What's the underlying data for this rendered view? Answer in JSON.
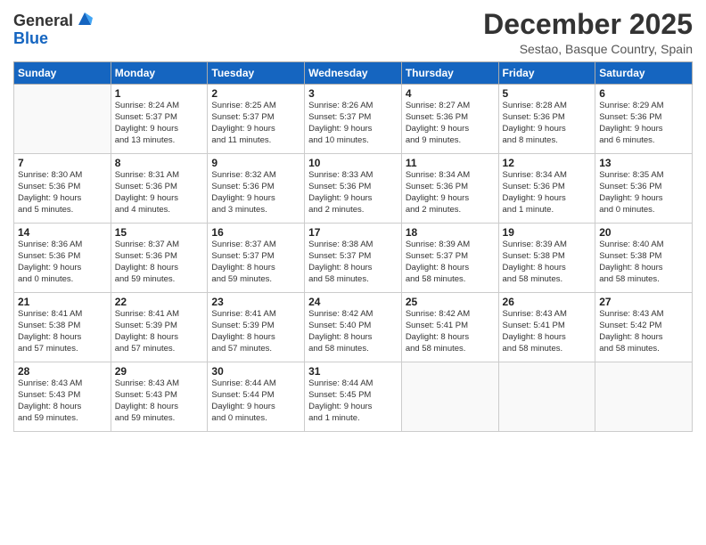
{
  "header": {
    "logo_general": "General",
    "logo_blue": "Blue",
    "month_title": "December 2025",
    "location": "Sestao, Basque Country, Spain"
  },
  "days_of_week": [
    "Sunday",
    "Monday",
    "Tuesday",
    "Wednesday",
    "Thursday",
    "Friday",
    "Saturday"
  ],
  "weeks": [
    [
      {
        "day": "",
        "info": ""
      },
      {
        "day": "1",
        "info": "Sunrise: 8:24 AM\nSunset: 5:37 PM\nDaylight: 9 hours\nand 13 minutes."
      },
      {
        "day": "2",
        "info": "Sunrise: 8:25 AM\nSunset: 5:37 PM\nDaylight: 9 hours\nand 11 minutes."
      },
      {
        "day": "3",
        "info": "Sunrise: 8:26 AM\nSunset: 5:37 PM\nDaylight: 9 hours\nand 10 minutes."
      },
      {
        "day": "4",
        "info": "Sunrise: 8:27 AM\nSunset: 5:36 PM\nDaylight: 9 hours\nand 9 minutes."
      },
      {
        "day": "5",
        "info": "Sunrise: 8:28 AM\nSunset: 5:36 PM\nDaylight: 9 hours\nand 8 minutes."
      },
      {
        "day": "6",
        "info": "Sunrise: 8:29 AM\nSunset: 5:36 PM\nDaylight: 9 hours\nand 6 minutes."
      }
    ],
    [
      {
        "day": "7",
        "info": "Sunrise: 8:30 AM\nSunset: 5:36 PM\nDaylight: 9 hours\nand 5 minutes."
      },
      {
        "day": "8",
        "info": "Sunrise: 8:31 AM\nSunset: 5:36 PM\nDaylight: 9 hours\nand 4 minutes."
      },
      {
        "day": "9",
        "info": "Sunrise: 8:32 AM\nSunset: 5:36 PM\nDaylight: 9 hours\nand 3 minutes."
      },
      {
        "day": "10",
        "info": "Sunrise: 8:33 AM\nSunset: 5:36 PM\nDaylight: 9 hours\nand 2 minutes."
      },
      {
        "day": "11",
        "info": "Sunrise: 8:34 AM\nSunset: 5:36 PM\nDaylight: 9 hours\nand 2 minutes."
      },
      {
        "day": "12",
        "info": "Sunrise: 8:34 AM\nSunset: 5:36 PM\nDaylight: 9 hours\nand 1 minute."
      },
      {
        "day": "13",
        "info": "Sunrise: 8:35 AM\nSunset: 5:36 PM\nDaylight: 9 hours\nand 0 minutes."
      }
    ],
    [
      {
        "day": "14",
        "info": "Sunrise: 8:36 AM\nSunset: 5:36 PM\nDaylight: 9 hours\nand 0 minutes."
      },
      {
        "day": "15",
        "info": "Sunrise: 8:37 AM\nSunset: 5:36 PM\nDaylight: 8 hours\nand 59 minutes."
      },
      {
        "day": "16",
        "info": "Sunrise: 8:37 AM\nSunset: 5:37 PM\nDaylight: 8 hours\nand 59 minutes."
      },
      {
        "day": "17",
        "info": "Sunrise: 8:38 AM\nSunset: 5:37 PM\nDaylight: 8 hours\nand 58 minutes."
      },
      {
        "day": "18",
        "info": "Sunrise: 8:39 AM\nSunset: 5:37 PM\nDaylight: 8 hours\nand 58 minutes."
      },
      {
        "day": "19",
        "info": "Sunrise: 8:39 AM\nSunset: 5:38 PM\nDaylight: 8 hours\nand 58 minutes."
      },
      {
        "day": "20",
        "info": "Sunrise: 8:40 AM\nSunset: 5:38 PM\nDaylight: 8 hours\nand 58 minutes."
      }
    ],
    [
      {
        "day": "21",
        "info": "Sunrise: 8:41 AM\nSunset: 5:38 PM\nDaylight: 8 hours\nand 57 minutes."
      },
      {
        "day": "22",
        "info": "Sunrise: 8:41 AM\nSunset: 5:39 PM\nDaylight: 8 hours\nand 57 minutes."
      },
      {
        "day": "23",
        "info": "Sunrise: 8:41 AM\nSunset: 5:39 PM\nDaylight: 8 hours\nand 57 minutes."
      },
      {
        "day": "24",
        "info": "Sunrise: 8:42 AM\nSunset: 5:40 PM\nDaylight: 8 hours\nand 58 minutes."
      },
      {
        "day": "25",
        "info": "Sunrise: 8:42 AM\nSunset: 5:41 PM\nDaylight: 8 hours\nand 58 minutes."
      },
      {
        "day": "26",
        "info": "Sunrise: 8:43 AM\nSunset: 5:41 PM\nDaylight: 8 hours\nand 58 minutes."
      },
      {
        "day": "27",
        "info": "Sunrise: 8:43 AM\nSunset: 5:42 PM\nDaylight: 8 hours\nand 58 minutes."
      }
    ],
    [
      {
        "day": "28",
        "info": "Sunrise: 8:43 AM\nSunset: 5:43 PM\nDaylight: 8 hours\nand 59 minutes."
      },
      {
        "day": "29",
        "info": "Sunrise: 8:43 AM\nSunset: 5:43 PM\nDaylight: 8 hours\nand 59 minutes."
      },
      {
        "day": "30",
        "info": "Sunrise: 8:44 AM\nSunset: 5:44 PM\nDaylight: 9 hours\nand 0 minutes."
      },
      {
        "day": "31",
        "info": "Sunrise: 8:44 AM\nSunset: 5:45 PM\nDaylight: 9 hours\nand 1 minute."
      },
      {
        "day": "",
        "info": ""
      },
      {
        "day": "",
        "info": ""
      },
      {
        "day": "",
        "info": ""
      }
    ]
  ]
}
